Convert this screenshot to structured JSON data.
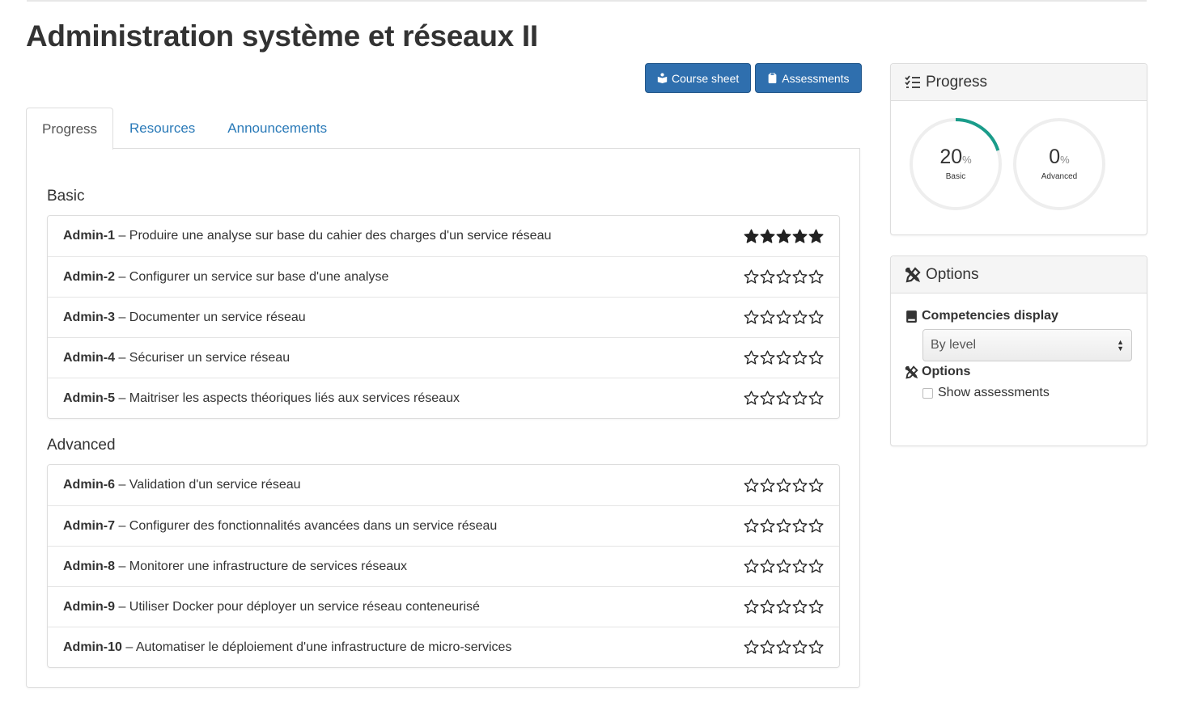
{
  "page": {
    "title": "Administration système et réseaux II"
  },
  "actions": {
    "course_sheet": "Course sheet",
    "assessments": "Assessments"
  },
  "tabs": [
    {
      "label": "Progress",
      "active": true
    },
    {
      "label": "Resources",
      "active": false
    },
    {
      "label": "Announcements",
      "active": false
    }
  ],
  "sections": [
    {
      "title": "Basic",
      "items": [
        {
          "code": "Admin-1",
          "text": " – Produire une analyse sur base du cahier des charges d'un service réseau",
          "stars": 5
        },
        {
          "code": "Admin-2",
          "text": " – Configurer un service sur base d'une analyse",
          "stars": 0
        },
        {
          "code": "Admin-3",
          "text": " – Documenter un service réseau",
          "stars": 0
        },
        {
          "code": "Admin-4",
          "text": " – Sécuriser un service réseau",
          "stars": 0
        },
        {
          "code": "Admin-5",
          "text": " – Maitriser les aspects théoriques liés aux services réseaux",
          "stars": 0
        }
      ]
    },
    {
      "title": "Advanced",
      "items": [
        {
          "code": "Admin-6",
          "text": " – Validation d'un service réseau",
          "stars": 0
        },
        {
          "code": "Admin-7",
          "text": " – Configurer des fonctionnalités avancées dans un service réseau",
          "stars": 0
        },
        {
          "code": "Admin-8",
          "text": " – Monitorer une infrastructure de services réseaux",
          "stars": 0
        },
        {
          "code": "Admin-9",
          "text": " – Utiliser Docker pour déployer un service réseau conteneurisé",
          "stars": 0
        },
        {
          "code": "Admin-10",
          "text": " – Automatiser le déploiement d'une infrastructure de micro-services",
          "stars": 0
        }
      ]
    }
  ],
  "progress_panel": {
    "title": "Progress",
    "gauges": [
      {
        "value": "20",
        "unit": "%",
        "label": "Basic",
        "fraction": 0.2
      },
      {
        "value": "0",
        "unit": "%",
        "label": "Advanced",
        "fraction": 0
      }
    ]
  },
  "options_panel": {
    "title": "Options",
    "competencies_display_label": "Competencies display",
    "display_select_value": "By level",
    "options_label": "Options",
    "show_assessments_label": "Show assessments",
    "show_assessments_checked": false
  },
  "colors": {
    "accent": "#2f6fae",
    "link": "#2a7ab8",
    "gauge_fill": "#1a9c8a",
    "gauge_track": "#eeeeee"
  },
  "icons": {
    "course_sheet": "book-reader-icon",
    "assessments": "clipboard-icon",
    "progress_heading": "tasks-list-icon",
    "options_heading": "tools-icon",
    "competencies_display": "book-icon",
    "options_label": "tools-icon"
  }
}
